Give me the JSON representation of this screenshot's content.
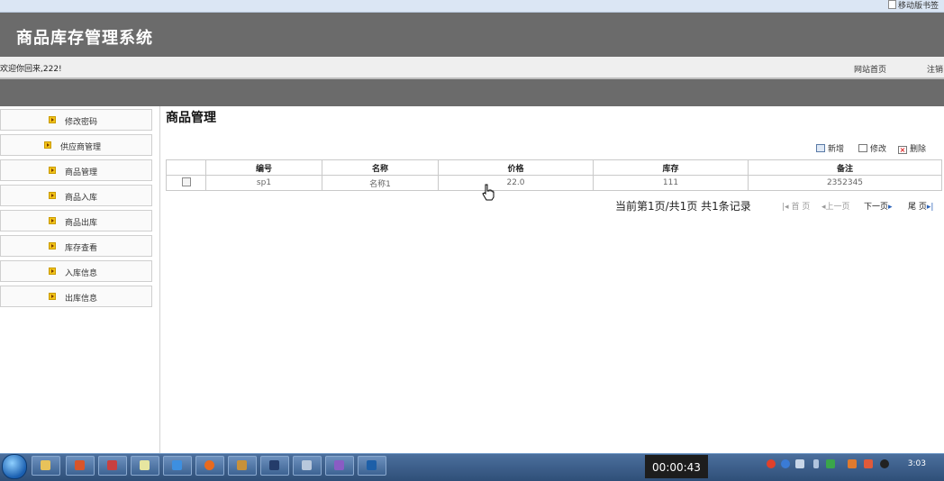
{
  "browser": {
    "bookmark_folder": "移动版书签"
  },
  "header": {
    "title": "商品库存管理系统"
  },
  "welcome": {
    "text": "欢迎你回来,222!",
    "home_link": "网站首页",
    "logout_link": "注销"
  },
  "sidebar": {
    "items": [
      {
        "label": "修改密码"
      },
      {
        "label": "供应商管理"
      },
      {
        "label": "商品管理"
      },
      {
        "label": "商品入库"
      },
      {
        "label": "商品出库"
      },
      {
        "label": "库存查看"
      },
      {
        "label": "入库信息"
      },
      {
        "label": "出库信息"
      }
    ]
  },
  "main": {
    "title": "商品管理",
    "toolbar": {
      "add": "新增",
      "edit": "修改",
      "delete": "删除"
    },
    "table": {
      "columns": [
        "编号",
        "名称",
        "价格",
        "库存",
        "备注"
      ],
      "rows": [
        {
          "id": "sp1",
          "name": "名称1",
          "price": "22.0",
          "stock": "111",
          "note": "2352345"
        }
      ]
    },
    "pager": {
      "summary": "当前第1页/共1页 共1条记录",
      "first": "首 页",
      "prev": "上一页",
      "next": "下一页",
      "last": "尾 页"
    }
  },
  "taskbar": {
    "timer": "00:00:43",
    "clock": "3:03"
  }
}
